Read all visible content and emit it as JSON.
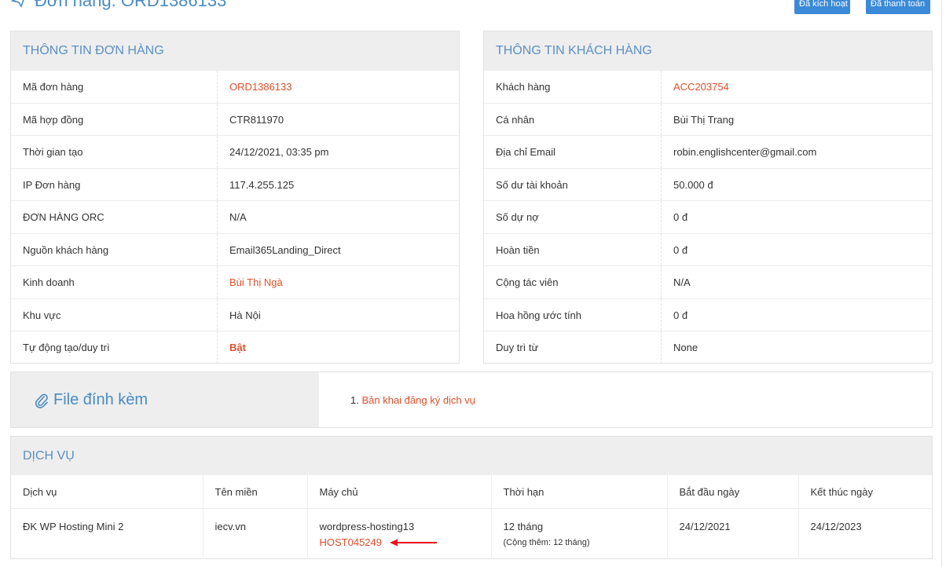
{
  "header": {
    "title": "Đơn hàng: ORD1386133",
    "badges": {
      "activated": "Đã kích hoạt",
      "paid": "Đã thanh toán"
    }
  },
  "order_info": {
    "title": "THÔNG TIN ĐƠN HÀNG",
    "rows": [
      {
        "label": "Mã đơn hàng",
        "value": "ORD1386133"
      },
      {
        "label": "Mã hợp đồng",
        "value": "CTR811970"
      },
      {
        "label": "Thời gian tạo",
        "value": "24/12/2021, 03:35 pm"
      },
      {
        "label": "IP Đơn hàng",
        "value": "117.4.255.125"
      },
      {
        "label": "ĐƠN HÀNG ORC",
        "value": "N/A"
      },
      {
        "label": "Nguồn khách hàng",
        "value": "Email365Landing_Direct"
      },
      {
        "label": "Kinh doanh",
        "value": "Bùi Thị Ngà"
      },
      {
        "label": "Khu vực",
        "value": "Hà Nội"
      },
      {
        "label": "Tự động tạo/duy trì",
        "value": "Bật"
      }
    ]
  },
  "customer_info": {
    "title": "THÔNG TIN KHÁCH HÀNG",
    "rows": [
      {
        "label": "Khách hàng",
        "value": "ACC203754"
      },
      {
        "label": "Cá nhân",
        "value": "Bùi Thị Trang"
      },
      {
        "label": "Địa chỉ Email",
        "value": "robin.englishcenter@gmail.com"
      },
      {
        "label": "Số dư tài khoản",
        "value": "50.000 đ"
      },
      {
        "label": "Số dự nợ",
        "value": "0 đ"
      },
      {
        "label": "Hoàn tiền",
        "value": "0 đ"
      },
      {
        "label": "Cộng tác viên",
        "value": "N/A"
      },
      {
        "label": "Hoa hồng ước tính",
        "value": "0 đ"
      },
      {
        "label": "Duy trì từ",
        "value": "None"
      }
    ]
  },
  "attachments": {
    "title": "File đính kèm",
    "items": [
      {
        "index": "1.",
        "label": "Bản khai đăng ký dịch vụ"
      }
    ]
  },
  "services": {
    "title": "DỊCH VỤ",
    "columns": [
      "Dịch vụ",
      "Tên miền",
      "Máy chủ",
      "Thời hạn",
      "Bắt đầu ngày",
      "Kết thúc ngày"
    ],
    "rows": [
      {
        "service": "ĐK WP Hosting Mini 2",
        "domain": "iecv.vn",
        "server": "wordpress-hosting13",
        "host": "HOST045249",
        "term": "12 tháng",
        "term_note": "(Cộng thêm: 12 tháng)",
        "start": "24/12/2021",
        "end": "24/12/2023"
      }
    ]
  },
  "colors": {
    "accent": "#4a8bc2",
    "link": "#e0502b",
    "badge": "#3b8ad8",
    "arrow": "#e8121b"
  }
}
